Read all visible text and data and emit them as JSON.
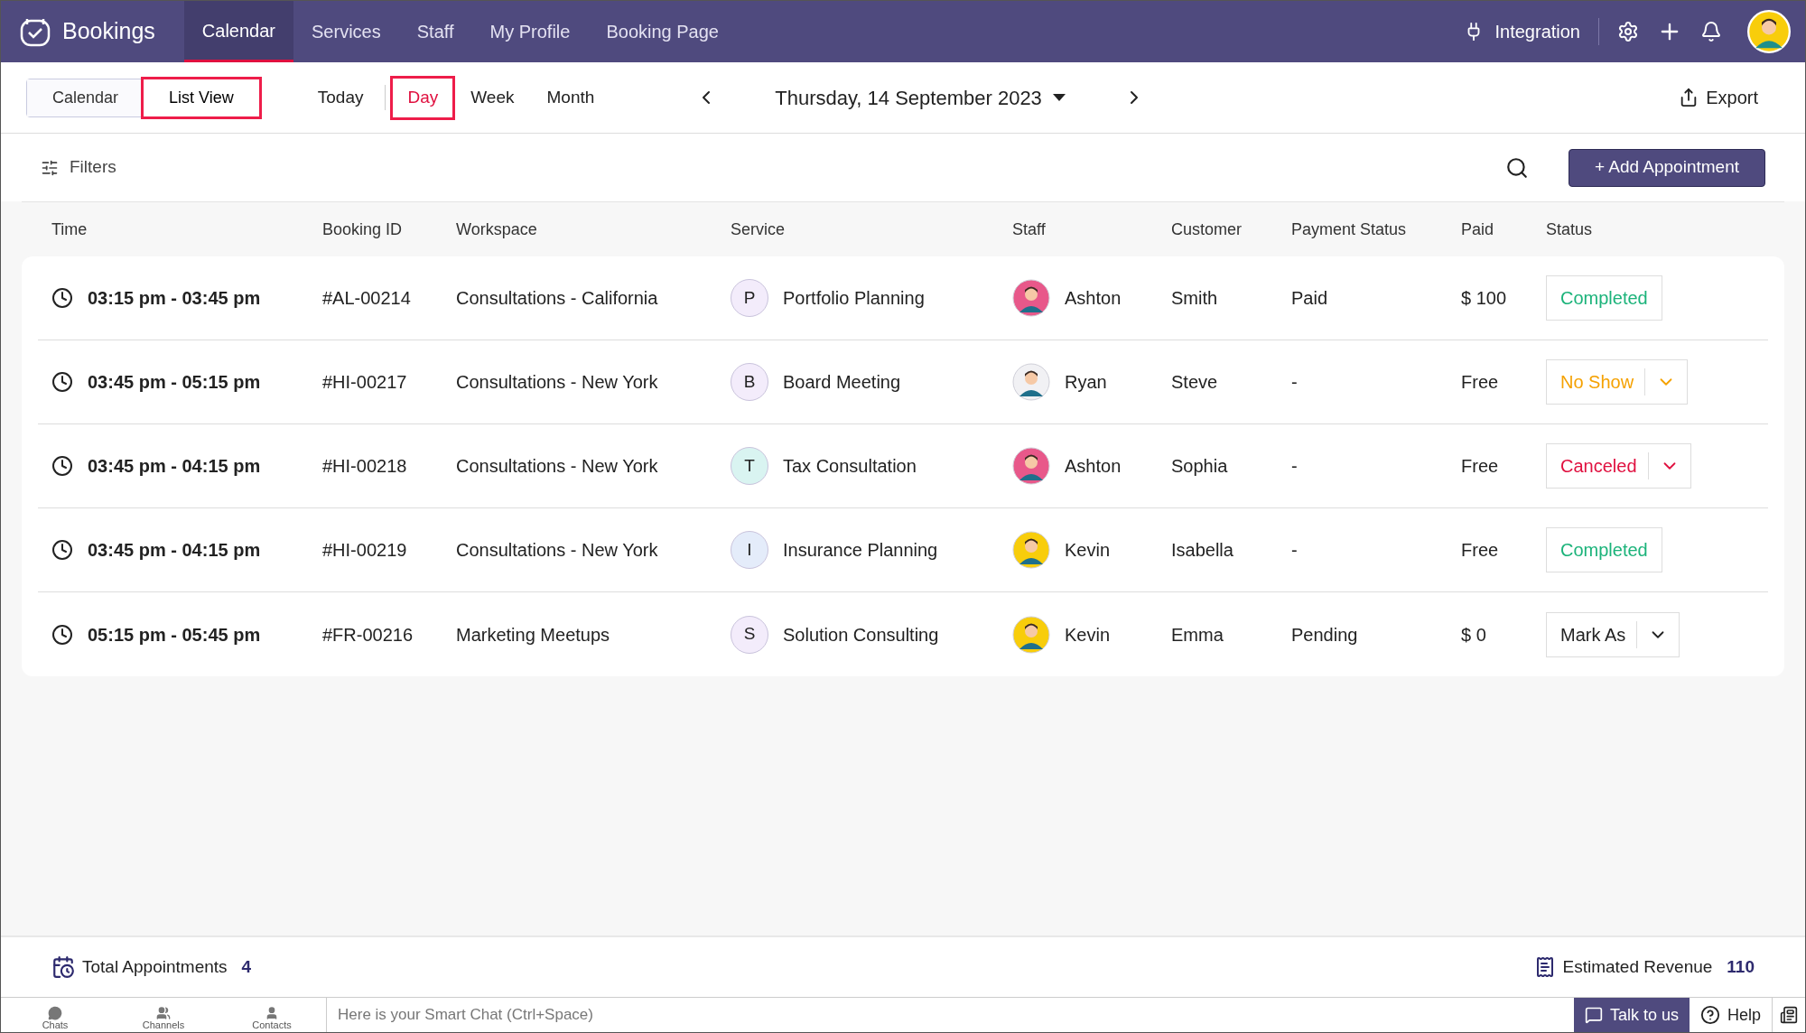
{
  "app": {
    "name": "Bookings"
  },
  "nav": [
    {
      "label": "Calendar",
      "selected": true
    },
    {
      "label": "Services",
      "selected": false
    },
    {
      "label": "Staff",
      "selected": false
    },
    {
      "label": "My Profile",
      "selected": false
    },
    {
      "label": "Booking Page",
      "selected": false
    }
  ],
  "integration": "Integration",
  "view_toggle": [
    {
      "label": "Calendar",
      "selected": false,
      "highlighted": false
    },
    {
      "label": "List View",
      "selected": true,
      "highlighted": true
    }
  ],
  "today": "Today",
  "ranges": [
    {
      "label": "Day",
      "selected": true,
      "highlighted": true
    },
    {
      "label": "Week",
      "selected": false,
      "highlighted": false
    },
    {
      "label": "Month",
      "selected": false,
      "highlighted": false
    }
  ],
  "date": "Thursday, 14 September 2023",
  "export": "Export",
  "filters": "Filters",
  "add_button": "+ Add Appointment",
  "table": {
    "columns": [
      "Time",
      "Booking ID",
      "Workspace",
      "Service",
      "Staff",
      "Customer",
      "Payment Status",
      "Paid",
      "Status"
    ],
    "rows": [
      {
        "time": "03:15 pm - 03:45 pm",
        "id": "#AL-00214",
        "workspace": "Consultations - California",
        "service": {
          "initial": "P",
          "name": "Portfolio Planning",
          "color": "#f3ecfb"
        },
        "staff": {
          "name": "Ashton",
          "color": "#e8588a"
        },
        "customer": "Smith",
        "payment": "Paid",
        "paid": "$ 100",
        "status": {
          "label": "Completed",
          "kind": "badge",
          "color": "#1bb37a"
        }
      },
      {
        "time": "03:45 pm - 05:15 pm",
        "id": "#HI-00217",
        "workspace": "Consultations - New York",
        "service": {
          "initial": "B",
          "name": "Board Meeting",
          "color": "#f3ecfb"
        },
        "staff": {
          "name": "Ryan",
          "color": "#f1f1f4"
        },
        "customer": "Steve",
        "payment": "-",
        "paid": "Free",
        "status": {
          "label": "No Show",
          "kind": "dropdown",
          "color": "#f5a100"
        }
      },
      {
        "time": "03:45 pm - 04:15 pm",
        "id": "#HI-00218",
        "workspace": "Consultations - New York",
        "service": {
          "initial": "T",
          "name": "Tax Consultation",
          "color": "#d9f4f1"
        },
        "staff": {
          "name": "Ashton",
          "color": "#e8588a"
        },
        "customer": "Sophia",
        "payment": "-",
        "paid": "Free",
        "status": {
          "label": "Canceled",
          "kind": "dropdown",
          "color": "#e0103f"
        }
      },
      {
        "time": "03:45 pm - 04:15 pm",
        "id": "#HI-00219",
        "workspace": "Consultations - New York",
        "service": {
          "initial": "I",
          "name": "Insurance Planning",
          "color": "#e4ecfa"
        },
        "staff": {
          "name": "Kevin",
          "color": "#f8cd0b"
        },
        "customer": "Isabella",
        "payment": "-",
        "paid": "Free",
        "status": {
          "label": "Completed",
          "kind": "badge",
          "color": "#1bb37a"
        }
      },
      {
        "time": "05:15 pm - 05:45 pm",
        "id": "#FR-00216",
        "workspace": "Marketing Meetups",
        "service": {
          "initial": "S",
          "name": "Solution Consulting",
          "color": "#f3ecfb"
        },
        "staff": {
          "name": "Kevin",
          "color": "#f8cd0b"
        },
        "customer": "Emma",
        "payment": "Pending",
        "paid": "$ 0",
        "status": {
          "label": "Mark As",
          "kind": "dropdown",
          "color": "#222222"
        }
      }
    ]
  },
  "summary": {
    "total_label": "Total Appointments",
    "total": "4",
    "revenue_label": "Estimated Revenue",
    "revenue": "110"
  },
  "bottom_bar": {
    "tabs": [
      "Chats",
      "Channels",
      "Contacts"
    ],
    "chat_placeholder": "Here is your Smart Chat (Ctrl+Space)",
    "talk": "Talk to us",
    "help": "Help"
  }
}
